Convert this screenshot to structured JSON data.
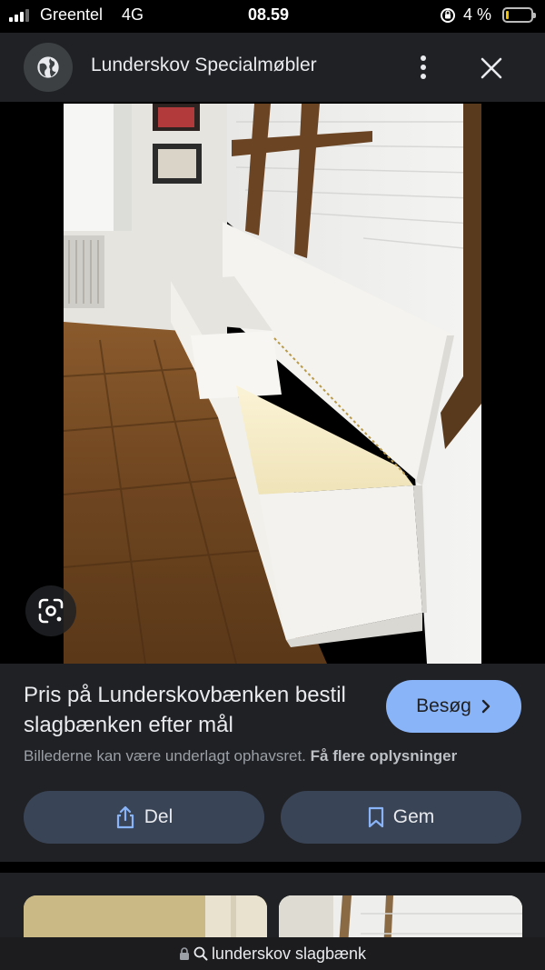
{
  "status_bar": {
    "carrier": "Greentel",
    "network": "4G",
    "time": "08.59",
    "battery_percent": "4 %",
    "battery_level": 0.04,
    "icons": [
      "signal-icon",
      "rotation-lock-icon",
      "battery-icon"
    ]
  },
  "header": {
    "site_name": "Lunderskov Specialmøbler",
    "icons": [
      "globe-icon",
      "more-vert-icon",
      "close-icon"
    ]
  },
  "image": {
    "icons": [
      "lens-icon"
    ]
  },
  "info": {
    "caption": "Pris på Lunderskovbænken bestil slagbænken efter mål",
    "visit_label": "Besøg",
    "copyright_text": "Billederne kan være underlagt ophavsret.",
    "more_info_link": "Få flere oplysninger",
    "share_label": "Del",
    "save_label": "Gem",
    "accent_color": "#8ab4f8"
  },
  "url_bar": {
    "query": "lunderskov slagbænk"
  }
}
